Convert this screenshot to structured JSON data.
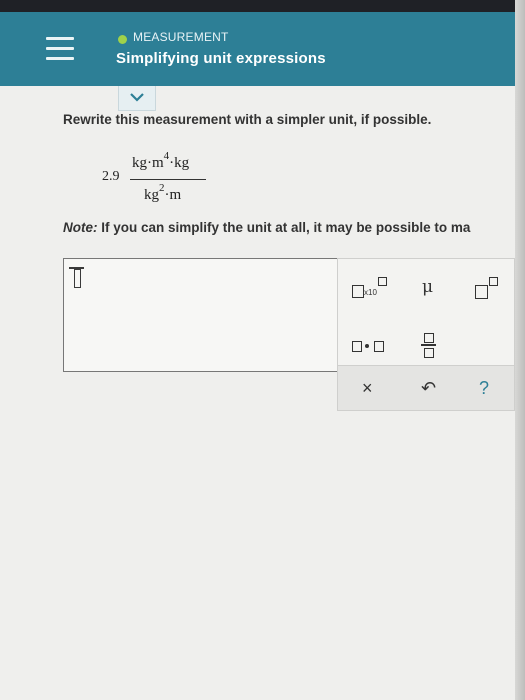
{
  "header": {
    "category": "MEASUREMENT",
    "title": "Simplifying unit expressions"
  },
  "question": {
    "prompt": "Rewrite this measurement with a simpler unit, if possible.",
    "coefficient": "2.9",
    "numerator_a": "kg·m",
    "numerator_exp": "4",
    "numerator_b": "·kg",
    "denominator_a": "kg",
    "denominator_exp": "2",
    "denominator_b": "·m",
    "note_label": "Note:",
    "note_text": "If you can simplify the unit at all, it may be possible to ma"
  },
  "palette": {
    "times_ten_label": "x10",
    "micro_symbol": "μ",
    "clear_symbol": "×",
    "undo_symbol": "↶",
    "help_symbol": "?"
  },
  "colors": {
    "header_bg": "#2d7f96",
    "status_dot": "#9fd24a"
  }
}
